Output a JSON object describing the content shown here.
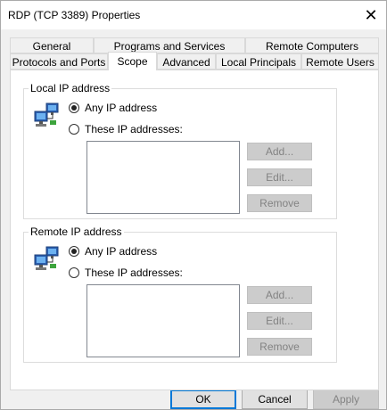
{
  "window": {
    "title": "RDP (TCP 3389) Properties",
    "close_glyph": "✕"
  },
  "tabs": {
    "row1": [
      "General",
      "Programs and Services",
      "Remote Computers"
    ],
    "row2": [
      "Protocols and Ports",
      "Scope",
      "Advanced",
      "Local Principals",
      "Remote Users"
    ],
    "active": "Scope"
  },
  "local": {
    "legend": "Local IP address",
    "icon": "network-computers-icon",
    "any_label": "Any IP address",
    "these_label": "These IP addresses:",
    "selected": "any",
    "buttons": {
      "add": "Add...",
      "edit": "Edit...",
      "remove": "Remove"
    }
  },
  "remote": {
    "legend": "Remote IP address",
    "icon": "network-computers-icon",
    "any_label": "Any IP address",
    "these_label": "These IP addresses:",
    "selected": "any",
    "buttons": {
      "add": "Add...",
      "edit": "Edit...",
      "remove": "Remove"
    }
  },
  "footer": {
    "ok": "OK",
    "cancel": "Cancel",
    "apply": "Apply"
  },
  "colors": {
    "accent": "#0078d7",
    "disabled_text": "#838383"
  }
}
